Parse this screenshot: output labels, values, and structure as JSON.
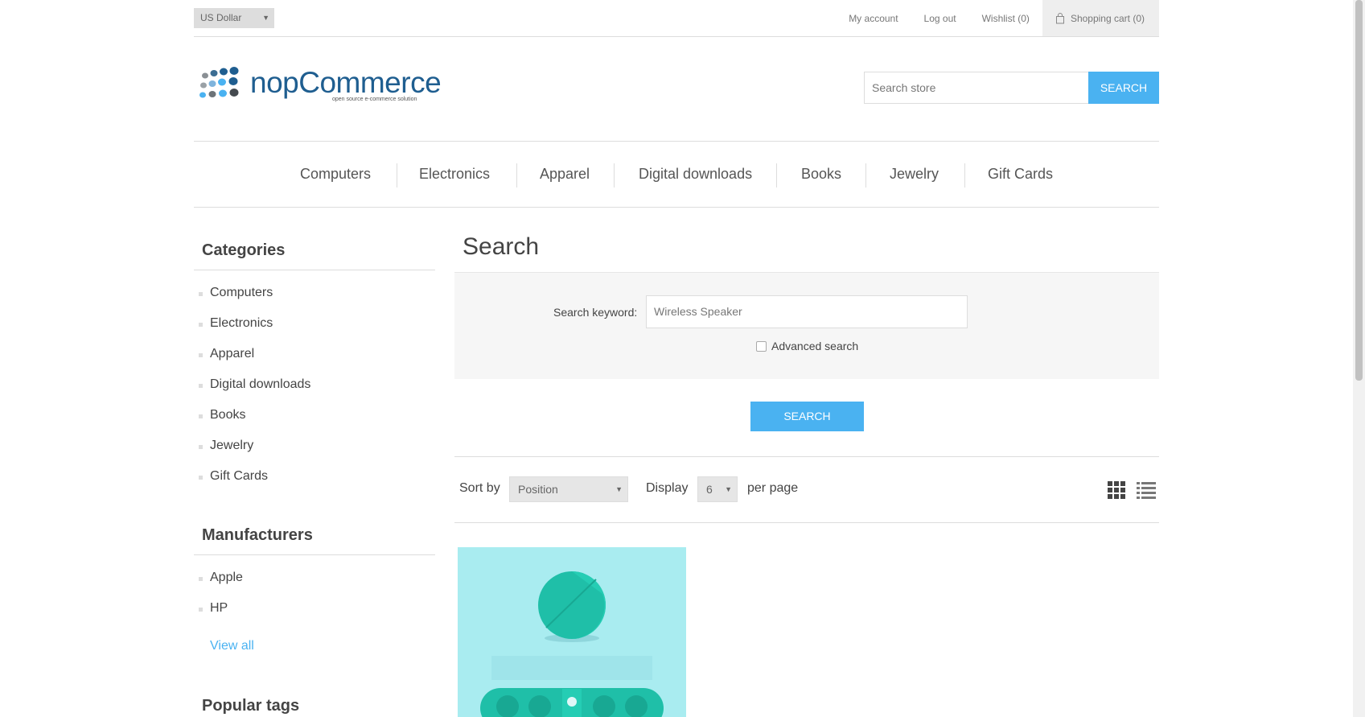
{
  "header": {
    "currency": "US Dollar",
    "links": {
      "my_account": "My account",
      "log_out": "Log out",
      "wishlist": "Wishlist (0)",
      "cart": "Shopping cart (0)"
    }
  },
  "logo": {
    "name": "nopCommerce",
    "tagline": "open source e-commerce solution"
  },
  "store_search": {
    "placeholder": "Search store",
    "button": "SEARCH"
  },
  "top_menu": [
    "Computers",
    "Electronics",
    "Apparel",
    "Digital downloads",
    "Books",
    "Jewelry",
    "Gift Cards"
  ],
  "sidebar": {
    "categories_title": "Categories",
    "categories": [
      "Computers",
      "Electronics",
      "Apparel",
      "Digital downloads",
      "Books",
      "Jewelry",
      "Gift Cards"
    ],
    "manufacturers_title": "Manufacturers",
    "manufacturers": [
      "Apple",
      "HP"
    ],
    "view_all": "View all",
    "popular_tags_title": "Popular tags"
  },
  "search_page": {
    "title": "Search",
    "keyword_label": "Search keyword:",
    "keyword_value": "Wireless Speaker",
    "advanced_label": "Advanced search",
    "advanced_checked": false,
    "submit": "SEARCH"
  },
  "product_selectors": {
    "sort_label": "Sort by",
    "sort_value": "Position",
    "display_label": "Display",
    "display_value": "6",
    "per_page_label": "per page"
  },
  "colors": {
    "accent": "#4ab2f1",
    "logo_blue": "#1f5e90",
    "product_bg": "#a9ecf0",
    "speaker": "#1fbfa8"
  }
}
